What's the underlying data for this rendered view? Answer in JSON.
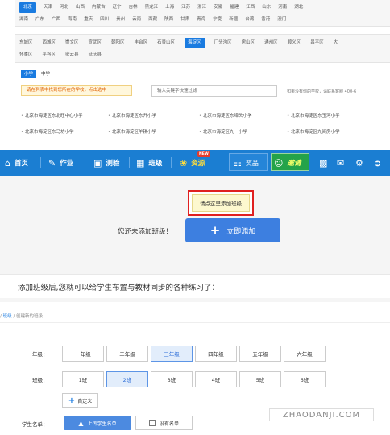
{
  "provinces": {
    "row1": [
      "北京",
      "天津",
      "河北",
      "山西",
      "内蒙古",
      "辽宁",
      "吉林",
      "黑龙江",
      "上海",
      "江苏",
      "浙江",
      "安徽",
      "福建",
      "江西",
      "山东",
      "河南",
      "湖北"
    ],
    "row2": [
      "湖南",
      "广东",
      "广西",
      "海南",
      "重庆",
      "四川",
      "贵州",
      "云南",
      "西藏",
      "陕西",
      "甘肃",
      "青海",
      "宁夏",
      "新疆",
      "台湾",
      "香港",
      "澳门"
    ],
    "selected": "北京"
  },
  "districts": {
    "row1": [
      "东城区",
      "西城区",
      "崇文区",
      "宣武区",
      "朝阳区",
      "丰台区",
      "石景山区",
      "海淀区",
      "门头沟区",
      "房山区",
      "通州区",
      "顺义区",
      "昌平区",
      "大"
    ],
    "row2": [
      "怀柔区",
      "平谷区",
      "密云县",
      "延庆县"
    ],
    "selected": "海淀区"
  },
  "levels": {
    "items": [
      "小学",
      "中学"
    ],
    "selected": "小学"
  },
  "school_search": {
    "warning": "请在列表中找到您所在的学校，点击选中",
    "placeholder": "输入关键字快速过滤",
    "contact": "如果没有你的学校，请联系客服 400-6"
  },
  "schools": [
    "北京市海淀区东北旺中心小学",
    "北京市海淀区东升小学",
    "北京市海淀区东埠头小学",
    "北京市海淀区东玉河小学",
    "北京市海淀区东马坊小学",
    "北京市海淀区羊耕小学",
    "北京市海淀区九一小学",
    "北京市海淀区九间房小学"
  ],
  "navbar": {
    "home": "首页",
    "homework": "作业",
    "quiz": "测验",
    "class": "班级",
    "resources": "资源",
    "resources_badge": "NEW",
    "prizes": "奖品",
    "invite": "邀请"
  },
  "icons": {
    "home": "home-icon",
    "homework": "edit-icon",
    "quiz": "quiz-icon",
    "class": "class-icon",
    "resources": "resources-icon",
    "prizes": "gift-icon",
    "invite": "invite-icon",
    "save": "save-icon",
    "mail": "mail-icon",
    "settings": "gear-icon",
    "logout": "logout-icon"
  },
  "empty_state": {
    "tooltip": "请点这里添加班级",
    "message": "您还未添加班级！",
    "add_button": "立即添加",
    "info": "添加班级后,您就可以给学生布置与教材同步的各种练习了："
  },
  "breadcrumb": {
    "parent": "班级",
    "current": "创建新的班级"
  },
  "form": {
    "grade_label": "年级：",
    "grades": [
      "一年级",
      "二年级",
      "三年级",
      "四年级",
      "五年级",
      "六年级"
    ],
    "grade_selected": "三年级",
    "class_label": "班级：",
    "classes": [
      "1班",
      "2班",
      "3班",
      "4班",
      "5班",
      "6班"
    ],
    "class_selected": "2班",
    "custom_button": "自定义",
    "roster_label": "学生名单：",
    "upload_button": "上传学生名单",
    "no_roster": "没有名单"
  },
  "watermark": "ZHAODANJI.COM",
  "colors": {
    "nav_bg": "#1b7ed2",
    "accent": "#1a7be0",
    "warning": "#e06000",
    "tooltip_border": "#e02020",
    "invite_bg": "#24a34a"
  }
}
